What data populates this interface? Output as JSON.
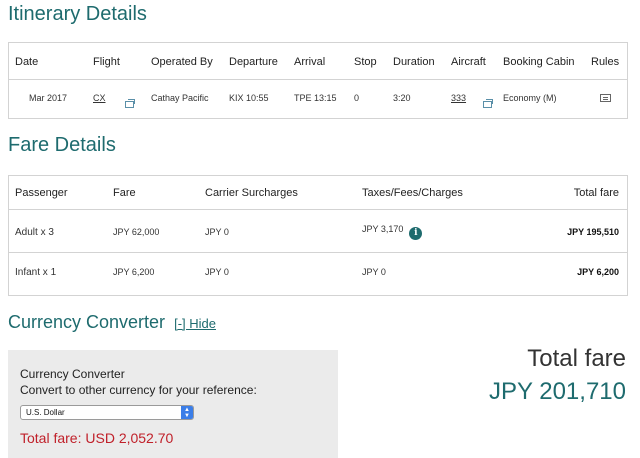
{
  "itinerary": {
    "title": "Itinerary Details",
    "headers": [
      "Date",
      "Flight",
      "Operated By",
      "Departure",
      "Arrival",
      "Stop",
      "Duration",
      "Aircraft",
      "Booking Cabin",
      "Rules"
    ],
    "row": {
      "date": "Mar 2017",
      "flight": "CX",
      "operated_by": "Cathay Pacific",
      "departure": "KIX 10:55",
      "arrival": "TPE 13:15",
      "stop": "0",
      "duration": "3:20",
      "aircraft": "333",
      "booking_cabin": "Economy (M)"
    },
    "icons": {
      "flight_popup": "popup-window-icon",
      "aircraft_popup": "popup-window-icon",
      "rules": "rules-document-icon"
    }
  },
  "fare": {
    "title": "Fare Details",
    "headers": [
      "Passenger",
      "Fare",
      "Carrier Surcharges",
      "Taxes/Fees/Charges",
      "Total fare"
    ],
    "rows": [
      {
        "passenger": "Adult x 3",
        "fare": "JPY 62,000",
        "surcharges": "JPY 0",
        "taxes": "JPY 3,170",
        "total": "JPY 195,510"
      },
      {
        "passenger": "Infant x 1",
        "fare": "JPY 6,200",
        "surcharges": "JPY 0",
        "taxes": "JPY 0",
        "total": "JPY 6,200"
      }
    ],
    "info_icon": "i"
  },
  "converter": {
    "title": "Currency Converter",
    "hide_link": "[-] Hide",
    "panel_title": "Currency Converter",
    "panel_subtitle": "Convert to other currency for your reference:",
    "selected_currency": "U.S. Dollar",
    "converted_total": "Total fare: USD 2,052.70"
  },
  "summary": {
    "label": "Total fare",
    "value": "JPY 201,710"
  },
  "colors": {
    "accent": "#1e6b6e",
    "alert": "#c0202a",
    "panel_bg": "#ebebeb"
  }
}
